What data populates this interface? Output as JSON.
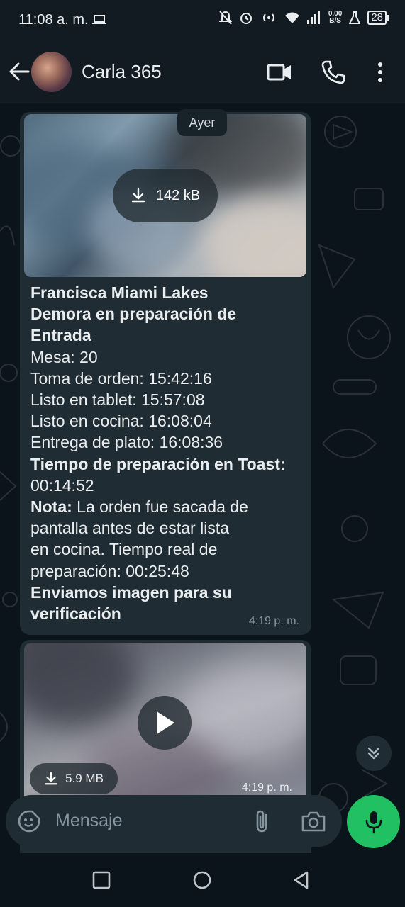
{
  "status_bar": {
    "time": "11:08 a. m.",
    "speed_value": "0.00",
    "speed_unit": "B/S",
    "battery": "28"
  },
  "header": {
    "contact_name": "Carla 365",
    "icons": [
      "back-arrow-icon",
      "video-call-icon",
      "phone-icon",
      "more-vert-icon"
    ]
  },
  "chat": {
    "date_chip": "Ayer",
    "message1": {
      "image_download_size": "142 kB",
      "lines": {
        "l1": "Francisca Miami Lakes",
        "l2": "Demora en preparación de",
        "l3": "Entrada",
        "l4": "Mesa: 20",
        "l5": "Toma de orden: 15:42:16",
        "l6": "Listo en tablet: 15:57:08",
        "l7": "Listo en cocina: 16:08:04",
        "l8": "Entrega de plato: 16:08:36",
        "l9": "Tiempo de preparación en Toast:",
        "l10": "00:14:52",
        "l11_label": "Nota:",
        "l11_rest": " La orden fue sacada de",
        "l12": "pantalla antes de estar lista",
        "l13": "en cocina. Tiempo real de",
        "l14": "preparación: 00:25:48",
        "l15": "Enviamos imagen para su",
        "l16": "verificación"
      },
      "timestamp": "4:19 p. m."
    },
    "message2": {
      "video_size": "5.9 MB",
      "timestamp": "4:19 p. m."
    }
  },
  "composer": {
    "placeholder": "Mensaje"
  },
  "colors": {
    "background": "#0b141a",
    "bar": "#111b21",
    "bubble": "#202c33",
    "accent": "#21c063",
    "muted_text": "#8696a0"
  }
}
